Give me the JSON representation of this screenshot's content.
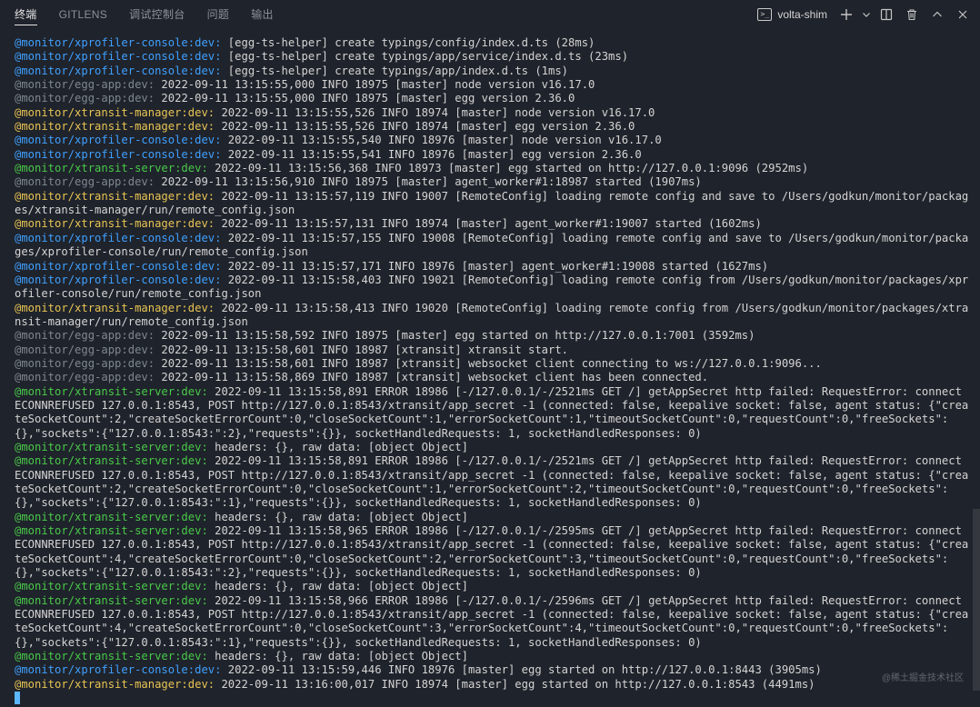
{
  "tabs": [
    "终端",
    "GITLENS",
    "调试控制台",
    "问题",
    "输出"
  ],
  "active_tab": 0,
  "terminal_name": "volta-shim",
  "watermark": "@稀土掘金技术社区",
  "colors": {
    "background": "#1f232b",
    "blue": "#3fa0ff",
    "yellow": "#e8c454",
    "green": "#49c94a",
    "gray": "#7f8791",
    "text": "#d4d4d4"
  },
  "lines": [
    {
      "prefix": "@monitor/xprofiler-console:dev:",
      "color": "blue",
      "text": " [egg-ts-helper] create typings/config/index.d.ts (28ms)"
    },
    {
      "prefix": "@monitor/xprofiler-console:dev:",
      "color": "blue",
      "text": " [egg-ts-helper] create typings/app/service/index.d.ts (23ms)"
    },
    {
      "prefix": "@monitor/xprofiler-console:dev:",
      "color": "blue",
      "text": " [egg-ts-helper] create typings/app/index.d.ts (1ms)"
    },
    {
      "prefix": "@monitor/egg-app:dev:",
      "color": "gray",
      "text": " 2022-09-11 13:15:55,000 INFO 18975 [master] node version v16.17.0"
    },
    {
      "prefix": "@monitor/egg-app:dev:",
      "color": "gray",
      "text": " 2022-09-11 13:15:55,000 INFO 18975 [master] egg version 2.36.0"
    },
    {
      "prefix": "@monitor/xtransit-manager:dev:",
      "color": "yellow",
      "text": " 2022-09-11 13:15:55,526 INFO 18974 [master] node version v16.17.0"
    },
    {
      "prefix": "@monitor/xtransit-manager:dev:",
      "color": "yellow",
      "text": " 2022-09-11 13:15:55,526 INFO 18974 [master] egg version 2.36.0"
    },
    {
      "prefix": "@monitor/xprofiler-console:dev:",
      "color": "blue",
      "text": " 2022-09-11 13:15:55,540 INFO 18976 [master] node version v16.17.0"
    },
    {
      "prefix": "@monitor/xprofiler-console:dev:",
      "color": "blue",
      "text": " 2022-09-11 13:15:55,541 INFO 18976 [master] egg version 2.36.0"
    },
    {
      "prefix": "@monitor/xtransit-server:dev:",
      "color": "green",
      "text": " 2022-09-11 13:15:56,368 INFO 18973 [master] egg started on http://127.0.0.1:9096 (2952ms)"
    },
    {
      "prefix": "@monitor/egg-app:dev:",
      "color": "gray",
      "text": " 2022-09-11 13:15:56,910 INFO 18975 [master] agent_worker#1:18987 started (1907ms)"
    },
    {
      "prefix": "@monitor/xtransit-manager:dev:",
      "color": "yellow",
      "text": " 2022-09-11 13:15:57,119 INFO 19007 [RemoteConfig] loading remote config and save to /Users/godkun/monitor/packages/xtransit-manager/run/remote_config.json"
    },
    {
      "prefix": "@monitor/xtransit-manager:dev:",
      "color": "yellow",
      "text": " 2022-09-11 13:15:57,131 INFO 18974 [master] agent_worker#1:19007 started (1602ms)"
    },
    {
      "prefix": "@monitor/xprofiler-console:dev:",
      "color": "blue",
      "text": " 2022-09-11 13:15:57,155 INFO 19008 [RemoteConfig] loading remote config and save to /Users/godkun/monitor/packages/xprofiler-console/run/remote_config.json"
    },
    {
      "prefix": "@monitor/xprofiler-console:dev:",
      "color": "blue",
      "text": " 2022-09-11 13:15:57,171 INFO 18976 [master] agent_worker#1:19008 started (1627ms)"
    },
    {
      "prefix": "@monitor/xprofiler-console:dev:",
      "color": "blue",
      "text": " 2022-09-11 13:15:58,403 INFO 19021 [RemoteConfig] loading remote config from /Users/godkun/monitor/packages/xprofiler-console/run/remote_config.json"
    },
    {
      "prefix": "@monitor/xtransit-manager:dev:",
      "color": "yellow",
      "text": " 2022-09-11 13:15:58,413 INFO 19020 [RemoteConfig] loading remote config from /Users/godkun/monitor/packages/xtransit-manager/run/remote_config.json"
    },
    {
      "prefix": "@monitor/egg-app:dev:",
      "color": "gray",
      "text": " 2022-09-11 13:15:58,592 INFO 18975 [master] egg started on http://127.0.0.1:7001 (3592ms)"
    },
    {
      "prefix": "@monitor/egg-app:dev:",
      "color": "gray",
      "text": " 2022-09-11 13:15:58,601 INFO 18987 [xtransit] xtransit start."
    },
    {
      "prefix": "@monitor/egg-app:dev:",
      "color": "gray",
      "text": " 2022-09-11 13:15:58,601 INFO 18987 [xtransit] websocket client connecting to ws://127.0.0.1:9096..."
    },
    {
      "prefix": "@monitor/egg-app:dev:",
      "color": "gray",
      "text": " 2022-09-11 13:15:58,869 INFO 18987 [xtransit] websocket client has been connected."
    },
    {
      "prefix": "@monitor/xtransit-server:dev:",
      "color": "green",
      "text": " 2022-09-11 13:15:58,891 ERROR 18986 [-/127.0.0.1/-/2521ms GET /] getAppSecret http failed: RequestError: connect ECONNREFUSED 127.0.0.1:8543, POST http://127.0.0.1:8543/xtransit/app_secret -1 (connected: false, keepalive socket: false, agent status: {\"createSocketCount\":2,\"createSocketErrorCount\":0,\"closeSocketCount\":1,\"errorSocketCount\":1,\"timeoutSocketCount\":0,\"requestCount\":0,\"freeSockets\":{},\"sockets\":{\"127.0.0.1:8543:\":2},\"requests\":{}}, socketHandledRequests: 1, socketHandledResponses: 0)"
    },
    {
      "prefix": "@monitor/xtransit-server:dev:",
      "color": "green",
      "text": " headers: {}, raw data: [object Object]"
    },
    {
      "prefix": "@monitor/xtransit-server:dev:",
      "color": "green",
      "text": " 2022-09-11 13:15:58,891 ERROR 18986 [-/127.0.0.1/-/2521ms GET /] getAppSecret http failed: RequestError: connect ECONNREFUSED 127.0.0.1:8543, POST http://127.0.0.1:8543/xtransit/app_secret -1 (connected: false, keepalive socket: false, agent status: {\"createSocketCount\":2,\"createSocketErrorCount\":0,\"closeSocketCount\":1,\"errorSocketCount\":2,\"timeoutSocketCount\":0,\"requestCount\":0,\"freeSockets\":{},\"sockets\":{\"127.0.0.1:8543:\":1},\"requests\":{}}, socketHandledRequests: 1, socketHandledResponses: 0)"
    },
    {
      "prefix": "@monitor/xtransit-server:dev:",
      "color": "green",
      "text": " headers: {}, raw data: [object Object]"
    },
    {
      "prefix": "@monitor/xtransit-server:dev:",
      "color": "green",
      "text": " 2022-09-11 13:15:58,965 ERROR 18986 [-/127.0.0.1/-/2595ms GET /] getAppSecret http failed: RequestError: connect ECONNREFUSED 127.0.0.1:8543, POST http://127.0.0.1:8543/xtransit/app_secret -1 (connected: false, keepalive socket: false, agent status: {\"createSocketCount\":4,\"createSocketErrorCount\":0,\"closeSocketCount\":2,\"errorSocketCount\":3,\"timeoutSocketCount\":0,\"requestCount\":0,\"freeSockets\":{},\"sockets\":{\"127.0.0.1:8543:\":2},\"requests\":{}}, socketHandledRequests: 1, socketHandledResponses: 0)"
    },
    {
      "prefix": "@monitor/xtransit-server:dev:",
      "color": "green",
      "text": " headers: {}, raw data: [object Object]"
    },
    {
      "prefix": "@monitor/xtransit-server:dev:",
      "color": "green",
      "text": " 2022-09-11 13:15:58,966 ERROR 18986 [-/127.0.0.1/-/2596ms GET /] getAppSecret http failed: RequestError: connect ECONNREFUSED 127.0.0.1:8543, POST http://127.0.0.1:8543/xtransit/app_secret -1 (connected: false, keepalive socket: false, agent status: {\"createSocketCount\":4,\"createSocketErrorCount\":0,\"closeSocketCount\":3,\"errorSocketCount\":4,\"timeoutSocketCount\":0,\"requestCount\":0,\"freeSockets\":{},\"sockets\":{\"127.0.0.1:8543:\":1},\"requests\":{}}, socketHandledRequests: 1, socketHandledResponses: 0)"
    },
    {
      "prefix": "@monitor/xtransit-server:dev:",
      "color": "green",
      "text": " headers: {}, raw data: [object Object]"
    },
    {
      "prefix": "@monitor/xprofiler-console:dev:",
      "color": "blue",
      "text": " 2022-09-11 13:15:59,446 INFO 18976 [master] egg started on http://127.0.0.1:8443 (3905ms)"
    },
    {
      "prefix": "@monitor/xtransit-manager:dev:",
      "color": "yellow",
      "text": " 2022-09-11 13:16:00,017 INFO 18974 [master] egg started on http://127.0.0.1:8543 (4491ms)"
    }
  ]
}
